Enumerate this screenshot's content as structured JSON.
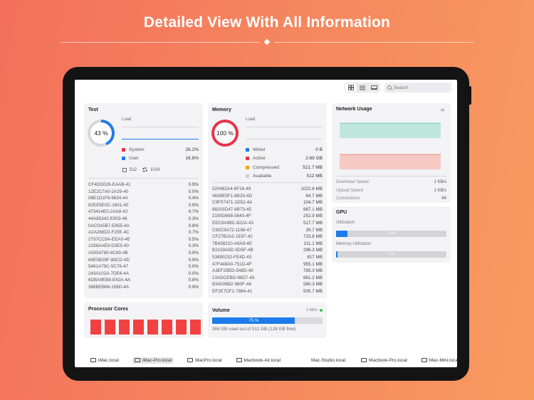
{
  "headline": "Detailed View With All Information",
  "toolbar": {
    "views": [
      "grid-icon",
      "list-icon",
      "monitor-icon"
    ],
    "search_placeholder": "Search"
  },
  "cpu": {
    "title": "Test",
    "percent_label": "43 %",
    "percent": 0.43,
    "load_label": "Load",
    "legend": [
      {
        "label": "System",
        "value": "26.2%",
        "color": "#e8334a"
      },
      {
        "label": "User",
        "value": "16.8%",
        "color": "#1d7bea"
      }
    ],
    "mem_label": "512",
    "cores_label": "1024",
    "processes": [
      {
        "name": "CF4DD028-EAAB-41",
        "value": "0.9%"
      },
      {
        "name": "12E2C7A0-2A29-40",
        "value": "0.0%"
      },
      {
        "name": "08E1D1F9-9634-44",
        "value": "0.4%"
      },
      {
        "name": "82EE5E0C-1601-40",
        "value": "0.9%"
      },
      {
        "name": "473414E0-2AA8-42",
        "value": "0.7%"
      },
      {
        "name": "44A85342-E903-46",
        "value": "0.3%"
      },
      {
        "name": "0AC0A5B7-E855-4A",
        "value": "0.8%"
      },
      {
        "name": "A2A266D2-F20E-4C",
        "value": "0.7%"
      },
      {
        "name": "2737CC9A-EEA0-4E",
        "value": "0.5%"
      },
      {
        "name": "1036AAE9-D3E5-40",
        "value": "0.3%"
      },
      {
        "name": "A5054780-4C89-4B",
        "value": "0.9%"
      },
      {
        "name": "69E5B28F-88CD-4D",
        "value": "0.9%"
      },
      {
        "name": "5461A79C-5C76-47",
        "value": "0.0%"
      },
      {
        "name": "243A102A-7DE6-4A",
        "value": "0.0%"
      },
      {
        "name": "6DBA9EB8-E42A-4A",
        "value": "0.8%"
      },
      {
        "name": "386BEB66-156D-4A",
        "value": "0.9%"
      }
    ]
  },
  "memory": {
    "title": "Memory",
    "percent_label": "100 %",
    "percent": 1.0,
    "load_label": "Load",
    "legend": [
      {
        "label": "Wired",
        "value": "0 B",
        "color": "#1d7bea"
      },
      {
        "label": "Active",
        "value": "2.69 GB",
        "color": "#e8334a"
      },
      {
        "label": "Compressed",
        "value": "521.7 MB",
        "color": "#f5a31a"
      },
      {
        "label": "Available",
        "value": "512 MB",
        "color": "#cfcfd4"
      }
    ],
    "processes": [
      {
        "name": "520482A4-8F16-49",
        "value": "1022.6 MB"
      },
      {
        "name": "4638E5F1-8B33-4D",
        "value": "64.7 MB"
      },
      {
        "name": "C9F07471-1D52-4A",
        "value": "104.7 MB"
      },
      {
        "name": "88203D47-6B73-45",
        "value": "687.1 MB"
      },
      {
        "name": "2190D698-5640-4F",
        "value": "252.9 MB"
      },
      {
        "name": "EEC6A98C-822A-43",
        "value": "517.7 MB"
      },
      {
        "name": "C93C9A72-1168-47",
        "value": "39.7 MB"
      },
      {
        "name": "CF27B2A2-1E87-42",
        "value": "715.8 MB"
      },
      {
        "name": "7B438210-A6A9-4E",
        "value": "211.1 MB"
      },
      {
        "name": "B2159A5D-5D5F-4B",
        "value": "296.3 MB"
      },
      {
        "name": "53890232-FE4D-43",
        "value": "817 MB"
      },
      {
        "name": "47F448A0-751D-4F",
        "value": "955.1 MB"
      },
      {
        "name": "A3EF29ED-548D-40",
        "value": "785.3 MB"
      },
      {
        "name": "13ADCEBD-86D7-43",
        "value": "661.2 MB"
      },
      {
        "name": "B34206B2-980F-44",
        "value": "580.3 MB"
      },
      {
        "name": "EF2E7CF1-7884-41",
        "value": "505.7 MB"
      }
    ]
  },
  "network": {
    "title": "Network Usage",
    "rows": [
      {
        "label": "Download Speed",
        "value": "1 KB/s"
      },
      {
        "label": "Upload Speed",
        "value": "1 KB/s"
      },
      {
        "label": "Connections",
        "value": "64"
      }
    ],
    "download_color": "#bfe6dc",
    "upload_color": "#f6c9c3"
  },
  "gpu": {
    "title": "GPU",
    "utilization_label": "Utilization",
    "utilization_value": 0.1,
    "utilization_text": "10 %",
    "memory_label": "Memory Utilization",
    "memory_value": 0.01,
    "memory_text": "1 %"
  },
  "cores": {
    "title": "Processor Cores",
    "count": 8,
    "color": "#f24141"
  },
  "volume": {
    "title": "Volume",
    "speed": "1 KB/s",
    "percent": 0.75,
    "percent_label": "75 %",
    "subtitle": "384 GB used out of 512 GB (128 GB free)"
  },
  "hosts": {
    "items": [
      {
        "label": "iMac.local",
        "icon": "imac-icon",
        "selected": false
      },
      {
        "label": "iMac-Pro.local",
        "icon": "imac-icon",
        "selected": true
      },
      {
        "label": "MacPro.local",
        "icon": "macpro-icon",
        "selected": false
      },
      {
        "label": "Macbook-Air.local",
        "icon": "laptop-icon",
        "selected": false
      },
      {
        "label": "Mac-Studio.local",
        "icon": "macstudio-icon",
        "selected": false
      },
      {
        "label": "Macbook-Pro.local",
        "icon": "laptop-icon",
        "selected": false
      },
      {
        "label": "Mac-Mini.local",
        "icon": "macmini-icon",
        "selected": false
      }
    ]
  }
}
